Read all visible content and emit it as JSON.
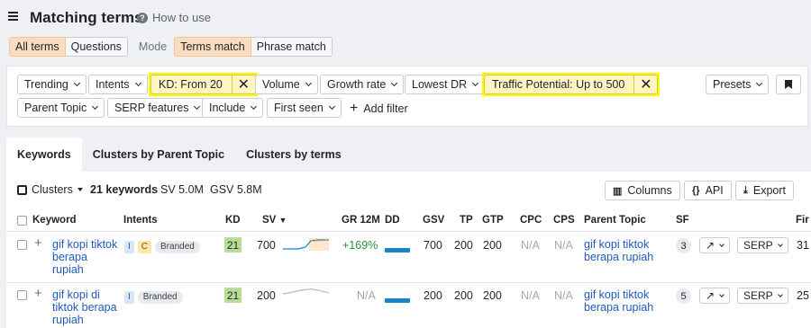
{
  "header": {
    "title": "Matching terms",
    "howto_label": "How to use"
  },
  "modebar": {
    "all_terms": "All terms",
    "questions": "Questions",
    "mode_label": "Mode",
    "terms_match": "Terms match",
    "phrase_match": "Phrase match"
  },
  "filters": {
    "trending": "Trending",
    "intents": "Intents",
    "kd": "KD: From 20",
    "volume": "Volume",
    "growth_rate": "Growth rate",
    "lowest_dr": "Lowest DR",
    "traffic_potential": "Traffic Potential: Up to 500",
    "presets": "Presets",
    "parent_topic": "Parent Topic",
    "serp_features": "SERP features",
    "include": "Include",
    "first_seen": "First seen",
    "add_filter": "Add filter"
  },
  "tabs": [
    "Keywords",
    "Clusters by Parent Topic",
    "Clusters by terms"
  ],
  "toolbar": {
    "clusters": "Clusters",
    "keyword_count": "21 keywords",
    "sv": "SV 5.0M",
    "gsv": "GSV 5.8M",
    "columns": "Columns",
    "api": "API",
    "export": "Export"
  },
  "table": {
    "headers": {
      "keyword": "Keyword",
      "intents": "Intents",
      "kd": "KD",
      "sv": "SV",
      "gr12m": "GR 12M",
      "dd": "DD",
      "gsv": "GSV",
      "tp": "TP",
      "gtp": "GTP",
      "cpc": "CPC",
      "cps": "CPS",
      "parent_topic": "Parent Topic",
      "sf": "SF",
      "fir": "Fir"
    },
    "rows": [
      {
        "keyword": "gif kopi tiktok berapa rupiah",
        "intent_badges": [
          "I",
          "C"
        ],
        "branded": "Branded",
        "kd": "21",
        "sv": "700",
        "gr": "+169%",
        "gsv": "700",
        "tp": "200",
        "gtp": "200",
        "cpc": "N/A",
        "cps": "N/A",
        "parent_topic": "gif kopi tiktok berapa rupiah",
        "sf": "3",
        "serp": "SERP",
        "first": "31"
      },
      {
        "keyword": "gif kopi di tiktok berapa rupiah",
        "intent_badges": [
          "I"
        ],
        "branded": "Branded",
        "kd": "21",
        "sv": "200",
        "gr": "N/A",
        "gsv": "200",
        "tp": "200",
        "gtp": "200",
        "cpc": "N/A",
        "cps": "N/A",
        "parent_topic": "gif kopi tiktok berapa rupiah",
        "sf": "5",
        "serp": "SERP",
        "first": "25"
      }
    ]
  },
  "colors": {
    "highlight": "#fff700",
    "link": "#1e5bb8",
    "kd_easy": "#b9dd98",
    "active_seg": "#fbdcbe",
    "growth": "#2a8a3f"
  }
}
